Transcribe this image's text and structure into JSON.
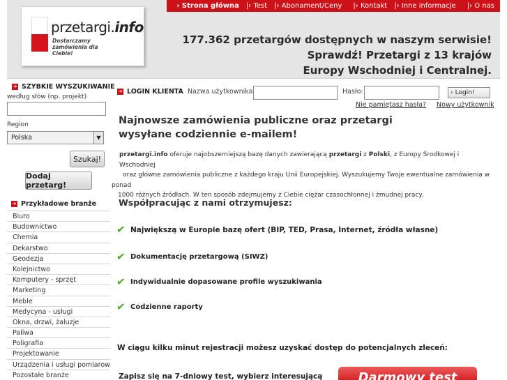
{
  "nav": [
    "Strona główna",
    "Test",
    "Abonament/Ceny",
    "Kontakt",
    "Inne informacje",
    "O nas"
  ],
  "logo": {
    "name_plain": "przetargi.",
    "name_bold": "info",
    "tagline": "Dostarczamy zamówienia dla Ciebie!"
  },
  "headline": [
    "177.362 przetargów dostępnych w naszym serwisie!",
    "Sprawdź! Przetargi z 13 krajów",
    "Europy Wschodniej i Centralnej."
  ],
  "quick_search": {
    "heading": "SZYBKIE WYSZUKIWANIE",
    "keywords_label": "według słów (np. projekt)",
    "keywords_value": "",
    "region_label": "Region",
    "region_value": "Polska",
    "search_button": "Szukaj!",
    "add_button": "Dodaj przetarg!"
  },
  "examples": {
    "heading": "Przykładowe branże",
    "items": [
      "Biuro",
      "Budownictwo",
      "Chemia",
      "Dekarstwo",
      "Geodezja",
      "Kolejnictwo",
      "Komputery - sprzęt",
      "Marketing",
      "Meble",
      "Medycyna - usługi",
      "Okna, drzwi, żaluzje",
      "Paliwa",
      "Poligrafia",
      "Projektowanie",
      "Urządzenia i usługi pomiarowe",
      "Pozostałe branże"
    ]
  },
  "login": {
    "heading": "LOGIN KLIENTA",
    "user_label": "Nazwa użytkownika:",
    "user_value": "",
    "pass_label": "Hasło:",
    "pass_value": "",
    "button": "Login!",
    "forgot": "Nie pamiętasz hasła?",
    "new_user": "Nowy użytkownik"
  },
  "intro": {
    "title": "Najnowsze zamówienia publiczne oraz przetargi wysyłane codziennie e-mailem!",
    "desc_line1": [
      "przetargi.info",
      " oferuje najobszerniejszą bazę danych zawierającą ",
      "przetargi",
      " z ",
      "Polski",
      ", z Europy Środkowej i Wschodniej"
    ],
    "desc_line2": "oraz główne zamówienia publiczne z każdego kraju Unii Europejskiej. Wyszukujemy Twoje ewentualne zamówienia w",
    "desc_line3": "ponad",
    "desc_line4": "1000 różnych źródłach. W ten sposób zdejmujemy z Ciebie ciężar czasochłonnej i żmudnej pracy."
  },
  "cooperation": {
    "heading": "Współpracując z nami otrzymujesz:",
    "features": [
      "Największą w Europie bazę ofert (BIP, TED, Prasa, Internet, źródła własne)",
      "Dokumentację przetargową (SIWZ)",
      "Indywidualnie dopasowane profile wyszukiwania",
      "Codzienne raporty"
    ]
  },
  "registration": "W ciągu kilku minut rejestracji możesz uzyskać dostęp do potencjalnych zleceń:",
  "trial": {
    "text": "Zapisz się na 7-dniowy test, wybierz interesującą",
    "button": "Darmowy test"
  },
  "colors": {
    "brand_red": "#cc1118",
    "check_green": "#4caa2a",
    "header_gray": "#e5e5e5"
  }
}
